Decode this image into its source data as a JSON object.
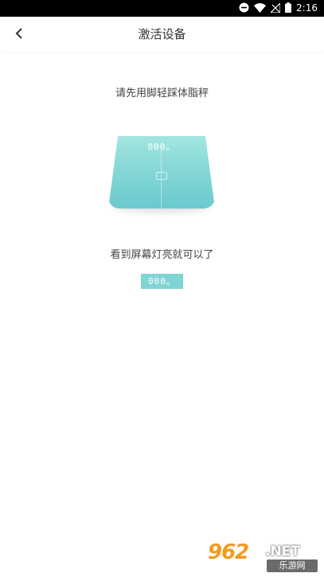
{
  "status_bar": {
    "time": "2:16",
    "icons": [
      "minus-circle-icon",
      "wifi-icon",
      "no-signal-icon",
      "battery-icon"
    ]
  },
  "header": {
    "title": "激活设备",
    "back_icon": "chevron-left-icon"
  },
  "main": {
    "instruction_top": "请先用脚轻踩体脂秤",
    "scale_display": "000。",
    "instruction_bottom": "看到屏幕灯亮就可以了",
    "display_badge": "000。"
  },
  "watermark": {
    "logo": "962",
    "suffix": ".NET",
    "text": "乐游网"
  },
  "colors": {
    "accent": "#7fd5d3",
    "scale_top": "#a4e6e0",
    "scale_bottom": "#6bc9cf",
    "watermark_orange": "#f29b1f"
  }
}
